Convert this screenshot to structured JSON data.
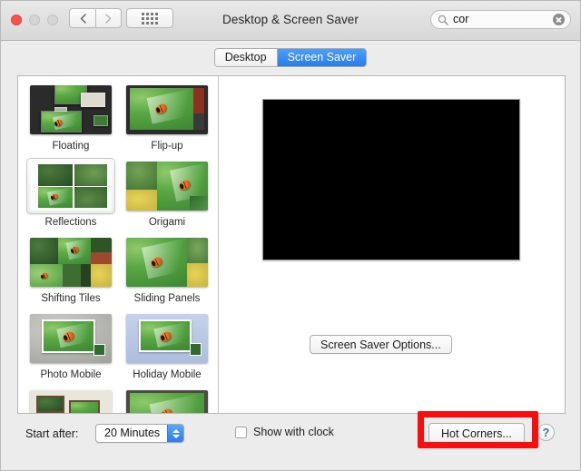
{
  "window": {
    "title": "Desktop & Screen Saver",
    "traffic_lights": [
      "close",
      "minimize",
      "zoom"
    ]
  },
  "toolbar": {
    "back_label": "Back",
    "forward_label": "Forward",
    "show_all_label": "Show All",
    "search": {
      "value": "cor",
      "placeholder": "Search",
      "clear_label": "Clear"
    }
  },
  "tabs": [
    {
      "label": "Desktop",
      "active": false
    },
    {
      "label": "Screen Saver",
      "active": true
    }
  ],
  "screensavers": [
    {
      "label": "Floating",
      "style": "floating",
      "selected": false
    },
    {
      "label": "Flip-up",
      "style": "flipup",
      "selected": false
    },
    {
      "label": "Reflections",
      "style": "reflections",
      "selected": true
    },
    {
      "label": "Origami",
      "style": "origami",
      "selected": false
    },
    {
      "label": "Shifting Tiles",
      "style": "shiftingtiles",
      "selected": false
    },
    {
      "label": "Sliding Panels",
      "style": "slidingpanels",
      "selected": false
    },
    {
      "label": "Photo Mobile",
      "style": "photomobile",
      "selected": false
    },
    {
      "label": "Holiday Mobile",
      "style": "holidaymobile",
      "selected": false
    },
    {
      "label": "",
      "style": "photowall",
      "selected": false
    },
    {
      "label": "",
      "style": "vintageprints",
      "selected": false
    }
  ],
  "preview": {
    "options_button": "Screen Saver Options..."
  },
  "footer": {
    "start_after_label": "Start after:",
    "start_after_value": "20 Minutes",
    "show_with_clock_label": "Show with clock",
    "show_with_clock_checked": false,
    "hot_corners_label": "Hot Corners...",
    "help_label": "?"
  },
  "annotation": {
    "color": "#fb0d0d",
    "target": "Hot Corners..."
  }
}
